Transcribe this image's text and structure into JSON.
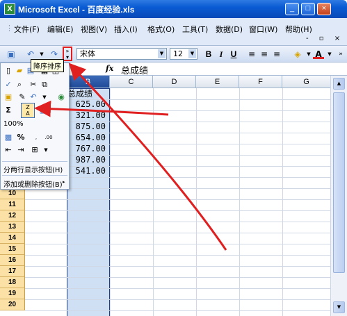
{
  "window": {
    "title": "Microsoft Excel - 百度经验.xls",
    "app_icon": "X",
    "minimize": "_",
    "maximize": "□",
    "close": "×"
  },
  "menu": {
    "items": [
      "文件(F)",
      "编辑(E)",
      "视图(V)",
      "插入(I)",
      "格式(O)",
      "工具(T)",
      "数据(D)",
      "窗口(W)",
      "帮助(H)"
    ],
    "doc_controls": "- ▫ ×"
  },
  "toolbar": {
    "font_name": "宋体",
    "font_size": "12",
    "bold": "B",
    "italic": "I",
    "underline": "U",
    "font_color_label": "A"
  },
  "formula_bar": {
    "fx": "fx",
    "content": "总成绩"
  },
  "grid": {
    "column_headers": [
      "B",
      "C",
      "D",
      "E",
      "F",
      "G"
    ],
    "row_headers": [
      "10",
      "11",
      "12",
      "13",
      "14",
      "15",
      "16",
      "17",
      "18",
      "19",
      "20"
    ],
    "header_cell": "总成绩",
    "values": [
      "625.00",
      "321.00",
      "875.00",
      "654.00",
      "767.00",
      "987.00",
      "541.00"
    ]
  },
  "float_panel": {
    "zoom": "100%",
    "sort_tooltip": "降序排序",
    "show_two_rows": "分两行显示按钮(H)",
    "add_remove_buttons": "添加或删除按钮(B)",
    "sort_icon_top": "Z",
    "sort_icon_bottom": "A",
    "sigma": "Σ",
    "percent": "%"
  },
  "colors": {
    "title_blue": "#0a5bd3",
    "selection_blue": "#cfe0f5",
    "row_header_orange": "#fbe1a6",
    "annotation_red": "#e02020"
  }
}
